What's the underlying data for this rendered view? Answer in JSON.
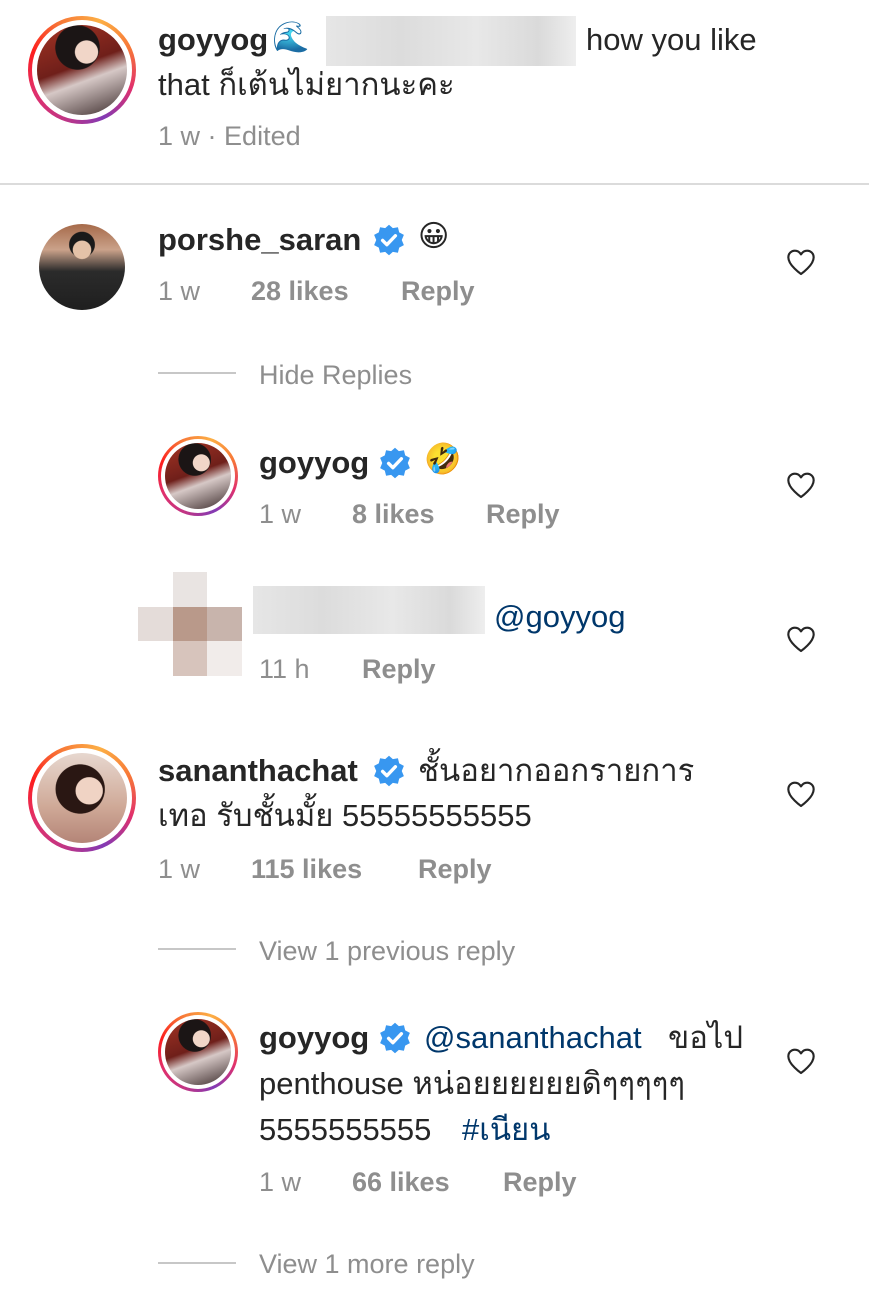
{
  "caption": {
    "username": "goyyog",
    "emoji": "🌊",
    "text_after": "how you like",
    "text_line2": "that ก็เต้นไม่ยากนะคะ",
    "time": "1 w",
    "edited": "Edited"
  },
  "comments": [
    {
      "username": "porshe_saran",
      "emoji": "😀",
      "time": "1 w",
      "likes": "28 likes",
      "reply": "Reply",
      "toggle": "Hide Replies",
      "replies": [
        {
          "username": "goyyog",
          "emoji": "🤣",
          "time": "1 w",
          "likes": "8 likes",
          "reply": "Reply"
        },
        {
          "mention": "@goyyog",
          "time": "11 h",
          "reply": "Reply"
        }
      ]
    },
    {
      "username": "sananthachat",
      "text_line1": "ชั้นอยากออกรายการ",
      "text_line2": "เทอ รับชั้นมั้ย 55555555555",
      "time": "1 w",
      "likes": "115 likes",
      "reply": "Reply",
      "toggle": "View 1 previous reply",
      "replies": [
        {
          "username": "goyyog",
          "mention": "@sananthachat",
          "text_after_mention": "ขอไป",
          "text_line2": "penthouse หน่อยยยยยยดิๆๆๆๆๆ",
          "text_line3_plain": "5555555555",
          "hashtag": "#เนียน",
          "time": "1 w",
          "likes": "66 likes",
          "reply": "Reply"
        }
      ],
      "more_toggle": "View 1 more reply"
    }
  ],
  "colors": {
    "text": "#262626",
    "meta": "#8e8e8e",
    "link": "#00376b",
    "verified": "#3897f0",
    "divider": "#dbdbdb"
  },
  "icons": [
    "verified-badge-icon",
    "heart-outline-icon"
  ]
}
